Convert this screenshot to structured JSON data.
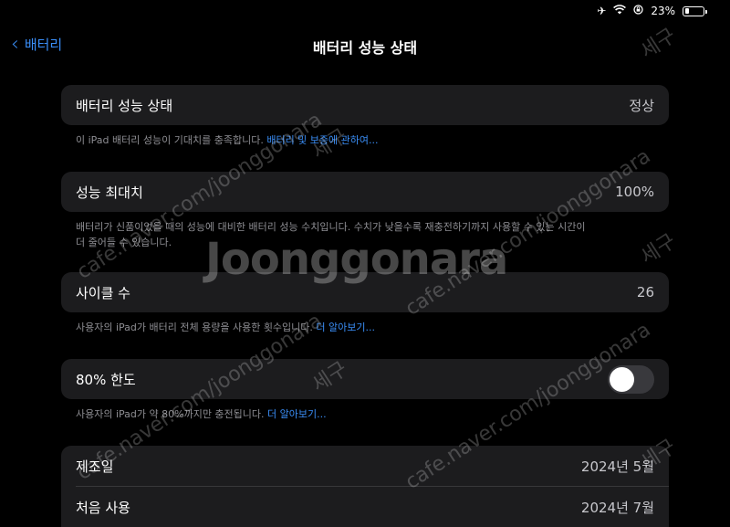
{
  "status_bar": {
    "airplane_icon": "airplane-icon",
    "wifi_icon": "wifi-icon",
    "lock_rotation_icon": "lock-rotation-icon",
    "battery_percent": "23%",
    "battery_level": 0.23
  },
  "nav": {
    "back_label": "배터리",
    "title": "배터리 성능 상태"
  },
  "health": {
    "label": "배터리 성능 상태",
    "value": "정상",
    "note_text": "이 iPad 배터리 성능이 기대치를 충족합니다. ",
    "note_link": "배터리 및 보증에 관하여..."
  },
  "max_capacity": {
    "label": "성능 최대치",
    "value": "100%",
    "note_line1": "배터리가 신품이었을 때의 성능에 대비한 배터리 성능 수치입니다. 수치가 낮을수록 재충전하기까지 사용할 수 있는 시간이",
    "note_line2": "더 줄어들 수 있습니다."
  },
  "cycle_count": {
    "label": "사이클 수",
    "value": "26",
    "note_text": "사용자의 iPad가 배터리 전체 용량을 사용한 횟수입니다. ",
    "note_link": "더 알아보기..."
  },
  "limit": {
    "label": "80% 한도",
    "enabled": false,
    "note_text": "사용자의 iPad가 약 80%까지만 충전됩니다. ",
    "note_link": "더 알아보기..."
  },
  "dates": {
    "manufacture_label": "제조일",
    "manufacture_value": "2024년 5월",
    "first_use_label": "처음 사용",
    "first_use_value": "2024년 7월"
  },
  "watermark": {
    "brand": "Joonggonara",
    "url": "cafe.naver.com/joonggonara",
    "seller": "세구"
  },
  "colors": {
    "accent": "#3a8ef7",
    "card": "#1c1c1e",
    "background": "#000000"
  }
}
